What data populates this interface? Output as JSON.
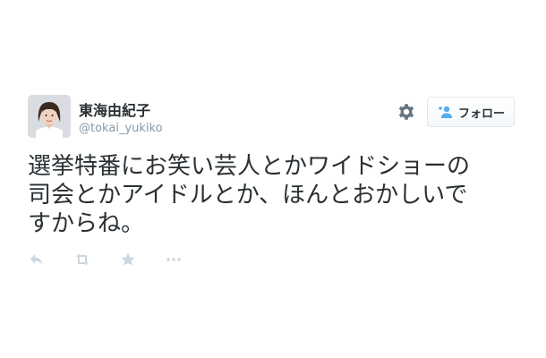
{
  "user": {
    "display_name": "東海由紀子",
    "handle": "@tokai_yukiko"
  },
  "header": {
    "settings_icon": "gear-icon",
    "follow_button": {
      "label": "フォロー",
      "icon": "add-user-icon"
    }
  },
  "tweet": {
    "lines": [
      "選挙特番にお笑い芸人とかワイドショーの",
      "司会とかアイドルとか、ほんとおかしいで",
      "すからね。"
    ]
  },
  "actions": {
    "reply_icon": "reply-icon",
    "retweet_icon": "retweet-icon",
    "favorite_icon": "star-icon",
    "more_icon": "more-icon"
  },
  "colors": {
    "text": "#292f33",
    "secondary": "#8899a6",
    "action_icons": "#ccd6dd",
    "button_border": "#e1e8ed",
    "follow_icon": "#55acee"
  }
}
